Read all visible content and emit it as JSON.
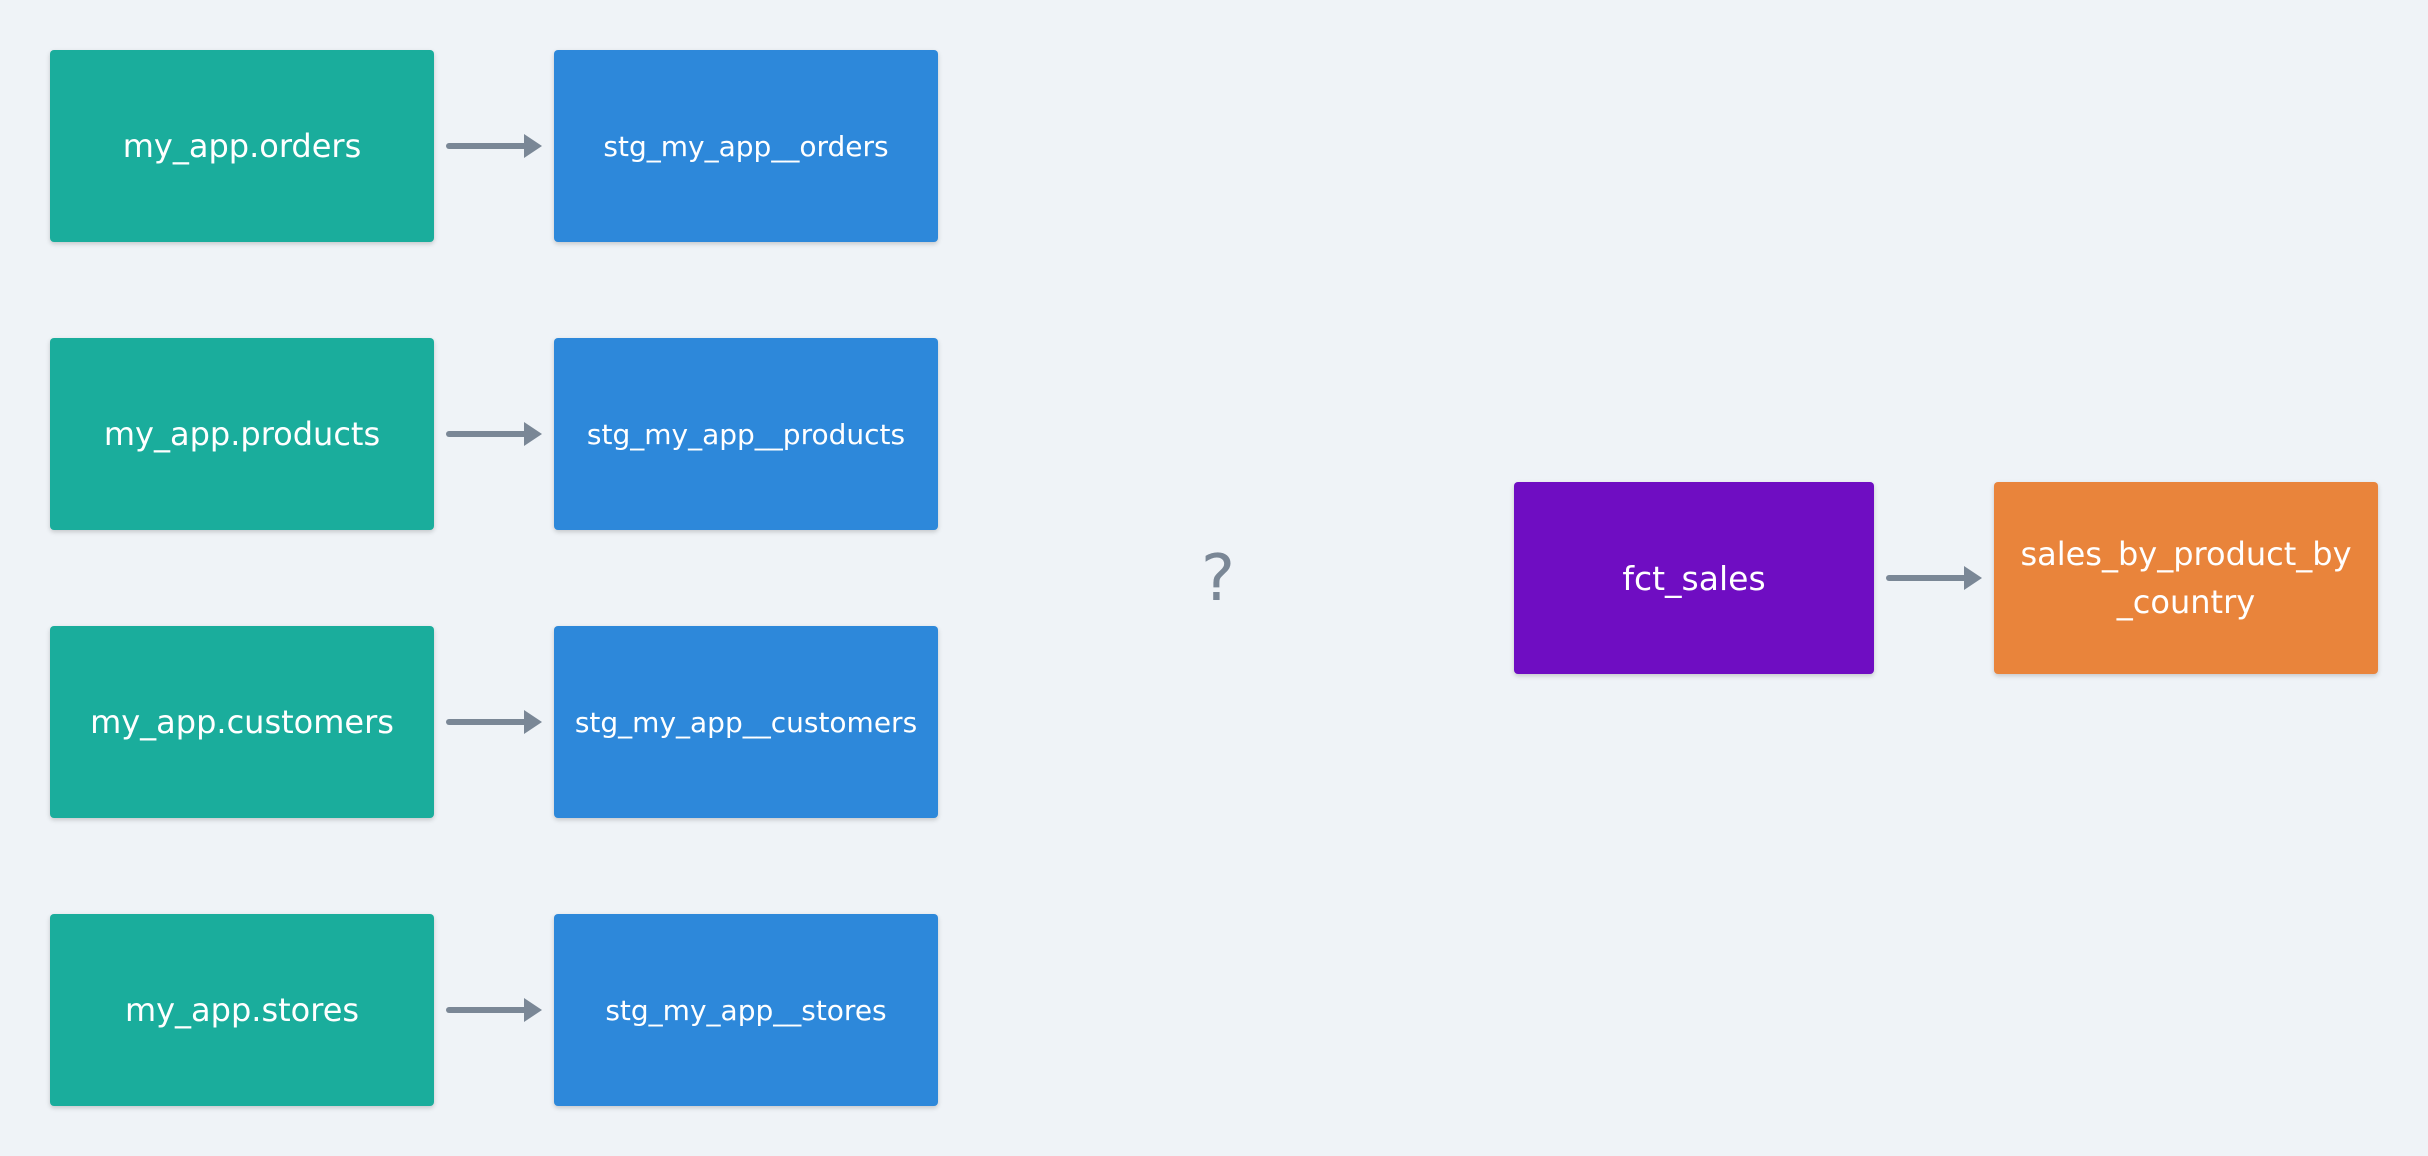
{
  "colors": {
    "background": "#eff3f7",
    "source": "#1aad9c",
    "staging": "#2d88da",
    "fact": "#6f0dc2",
    "aggregate": "#e9843b",
    "arrow": "#7a8796"
  },
  "sources": [
    {
      "label": "my_app.orders"
    },
    {
      "label": "my_app.products"
    },
    {
      "label": "my_app.customers"
    },
    {
      "label": "my_app.stores"
    }
  ],
  "staging": [
    {
      "label": "stg_my_app__orders"
    },
    {
      "label": "stg_my_app__products"
    },
    {
      "label": "stg_my_app__customers"
    },
    {
      "label": "stg_my_app__stores"
    }
  ],
  "middle": {
    "label": "?"
  },
  "fact": {
    "label": "fct_sales"
  },
  "aggregate": {
    "line1": "sales_by_product_by",
    "line2": "_country"
  }
}
